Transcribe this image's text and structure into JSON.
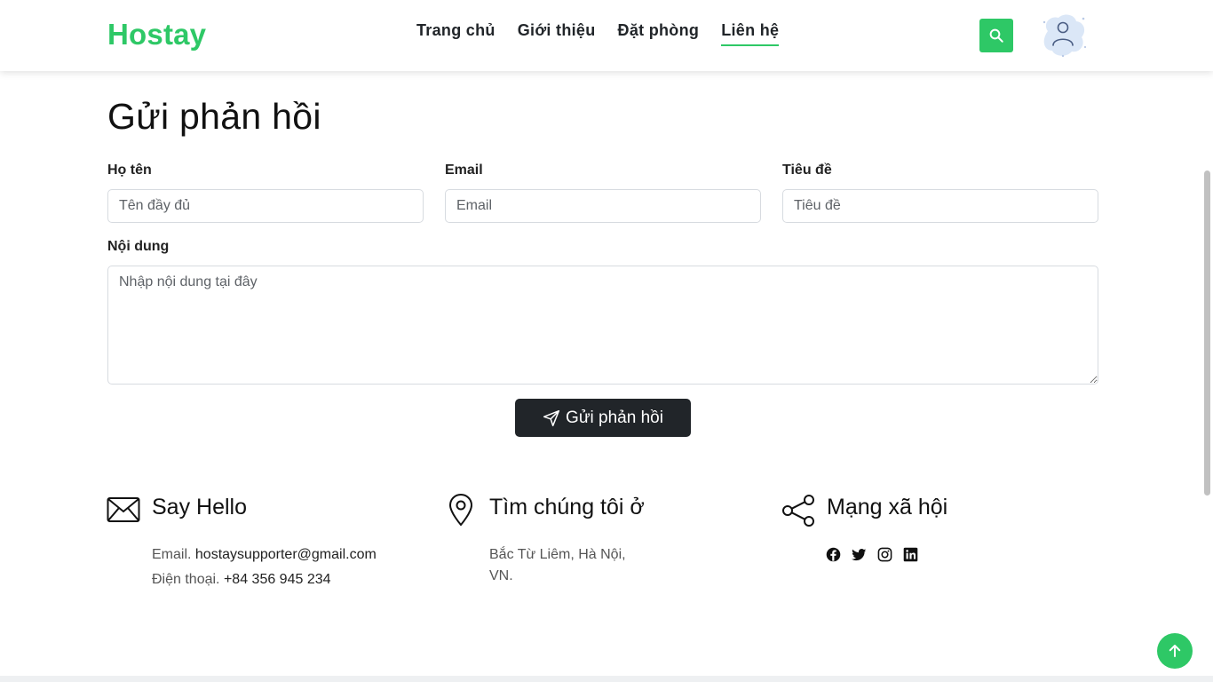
{
  "brand": "Hostay",
  "nav": {
    "items": [
      {
        "label": "Trang chủ"
      },
      {
        "label": "Giới thiệu"
      },
      {
        "label": "Đặt phòng"
      },
      {
        "label": "Liên hệ"
      }
    ],
    "active": "Liên hệ"
  },
  "page_title": "Gửi phản hồi",
  "form": {
    "name_label": "Họ tên",
    "name_placeholder": "Tên đầy đủ",
    "email_label": "Email",
    "email_placeholder": "Email",
    "subject_label": "Tiêu đề",
    "subject_placeholder": "Tiêu đề",
    "content_label": "Nội dung",
    "content_placeholder": "Nhập nội dung tại đây",
    "submit_label": "Gửi phản hồi"
  },
  "contact": {
    "hello_title": "Say Hello",
    "email_prefix": "Email.",
    "email_value": "hostaysupporter@gmail.com",
    "phone_prefix": "Điện thoại.",
    "phone_value": "+84 356 945 234",
    "location_title": "Tìm chúng tôi ở",
    "address_line1": "Bắc Từ Liêm, Hà Nội,",
    "address_line2": "VN.",
    "social_title": "Mạng xã hội",
    "social_icons": [
      "facebook-icon",
      "twitter-icon",
      "instagram-icon",
      "linkedin-icon"
    ]
  },
  "colors": {
    "accent": "#2ec866",
    "dark_button": "#212529"
  }
}
